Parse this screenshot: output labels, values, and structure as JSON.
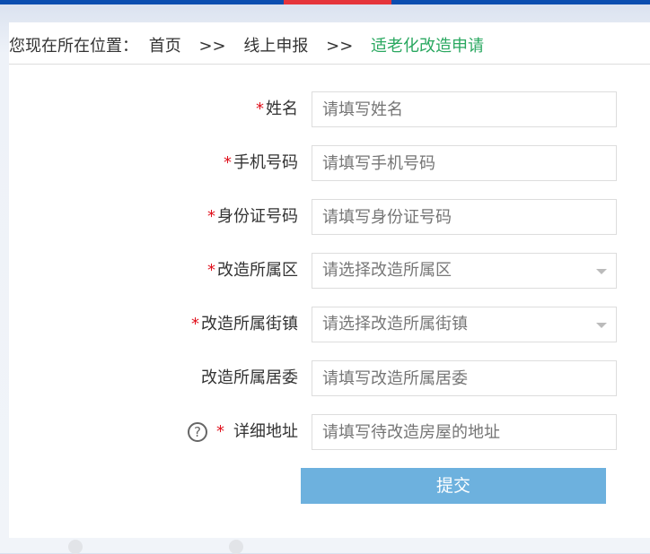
{
  "breadcrumb": {
    "prefix": "您现在所在位置：",
    "items": [
      "首页",
      ">>",
      "线上申报",
      ">>"
    ],
    "current": "适老化改造申请"
  },
  "form": {
    "fields": [
      {
        "label": "姓名",
        "required": true,
        "placeholder": "请填写姓名",
        "type": "text"
      },
      {
        "label": "手机号码",
        "required": true,
        "placeholder": "请填写手机号码",
        "type": "text"
      },
      {
        "label": "身份证号码",
        "required": true,
        "placeholder": "请填写身份证号码",
        "type": "text"
      },
      {
        "label": "改造所属区",
        "required": true,
        "placeholder": "请选择改造所属区",
        "type": "select"
      },
      {
        "label": "改造所属街镇",
        "required": true,
        "placeholder": "请选择改造所属街镇",
        "type": "select"
      },
      {
        "label": "改造所属居委",
        "required": false,
        "placeholder": "请填写改造所属居委",
        "type": "text"
      },
      {
        "label": "详细地址",
        "required": true,
        "placeholder": "请填写待改造房屋的地址",
        "type": "text",
        "help": "?"
      }
    ],
    "star": "*",
    "submit": "提交"
  }
}
